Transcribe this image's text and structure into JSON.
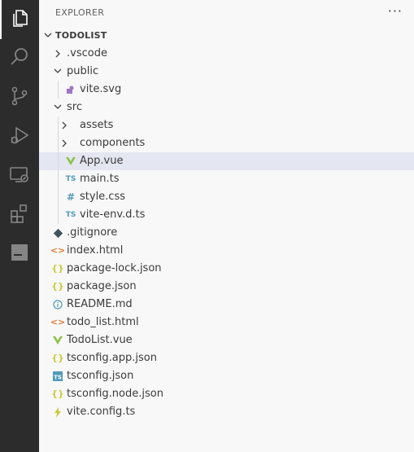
{
  "explorer": {
    "title": "EXPLORER",
    "more_label": "···",
    "root_label": "TODOLIST"
  },
  "activity_bar": [
    {
      "icon": "files-icon",
      "active": true
    },
    {
      "icon": "search-icon"
    },
    {
      "icon": "source-control-icon"
    },
    {
      "icon": "run-debug-icon"
    },
    {
      "icon": "remote-explorer-icon"
    },
    {
      "icon": "extensions-icon"
    },
    {
      "icon": "panel-icon"
    }
  ],
  "tree": [
    {
      "label": ".vscode",
      "kind": "folder",
      "expanded": false,
      "depth": 1
    },
    {
      "label": "public",
      "kind": "folder",
      "expanded": true,
      "depth": 1
    },
    {
      "label": "vite.svg",
      "kind": "svg",
      "depth": 2
    },
    {
      "label": "src",
      "kind": "folder",
      "expanded": true,
      "depth": 1
    },
    {
      "label": "assets",
      "kind": "folder",
      "expanded": false,
      "depth": 2
    },
    {
      "label": "components",
      "kind": "folder",
      "expanded": false,
      "depth": 2
    },
    {
      "label": "App.vue",
      "kind": "vue",
      "depth": 2,
      "selected": true
    },
    {
      "label": "main.ts",
      "kind": "ts",
      "depth": 2
    },
    {
      "label": "style.css",
      "kind": "css",
      "depth": 2
    },
    {
      "label": "vite-env.d.ts",
      "kind": "ts",
      "depth": 2
    },
    {
      "label": ".gitignore",
      "kind": "git",
      "depth": 1
    },
    {
      "label": "index.html",
      "kind": "html",
      "depth": 1
    },
    {
      "label": "package-lock.json",
      "kind": "json",
      "depth": 1
    },
    {
      "label": "package.json",
      "kind": "json",
      "depth": 1
    },
    {
      "label": "README.md",
      "kind": "info",
      "depth": 1
    },
    {
      "label": "todo_list.html",
      "kind": "html",
      "depth": 1
    },
    {
      "label": "TodoList.vue",
      "kind": "vue",
      "depth": 1
    },
    {
      "label": "tsconfig.app.json",
      "kind": "json",
      "depth": 1
    },
    {
      "label": "tsconfig.json",
      "kind": "tsconfig",
      "depth": 1
    },
    {
      "label": "tsconfig.node.json",
      "kind": "json",
      "depth": 1
    },
    {
      "label": "vite.config.ts",
      "kind": "vite",
      "depth": 1
    }
  ],
  "colors": {
    "activity_bar": "#2c2c2c",
    "activity_icon": "#858585",
    "activity_icon_active": "#ffffff",
    "sidebar": "#f8f8f8",
    "selected_row": "#e4e6f1",
    "ts": "#519aba",
    "vue": "#8dc149",
    "json": "#cbcb41",
    "html": "#e37933",
    "git": "#41535b",
    "svg": "#a074c4",
    "info": "#519aba",
    "vite": "#cbcb41"
  }
}
